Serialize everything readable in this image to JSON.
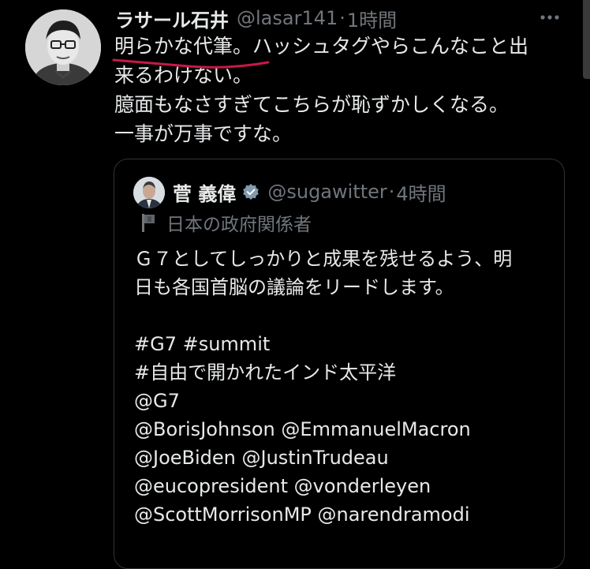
{
  "tweet": {
    "display_name": "ラサール石井",
    "handle": "@lasar141",
    "separator": "·",
    "time": "1時間",
    "text": "明らかな代筆。ハッシュタグやらこんなこと出\n来るわけない。\n臆面もなさすぎてこちらが恥ずかしくなる。\n一事が万事ですな。",
    "more_icon": "ellipsis-icon"
  },
  "quote": {
    "display_name": "菅 義偉",
    "verified_icon": "verified-badge-icon",
    "handle": "@sugawitter",
    "separator": "·",
    "time": "4時間",
    "label": "日本の政府関係者",
    "label_icon": "flag-icon",
    "lines": [
      "Ｇ７としてしっかりと成果を残せるよう、明",
      "日も各国首脳の議論をリードします。",
      "",
      "#G7 #summit",
      "#自由で開かれたインド太平洋",
      "@G7",
      "@BorisJohnson @EmmanuelMacron",
      "@JoeBiden @JustinTrudeau",
      "@eucopresident @vonderleyen",
      "@ScottMorrisonMP @narendramodi"
    ]
  },
  "colors": {
    "background": "#000000",
    "text": "#e7e9ea",
    "muted": "#71767b",
    "border": "#2f3336",
    "underline_annotation": "#c8184a"
  }
}
